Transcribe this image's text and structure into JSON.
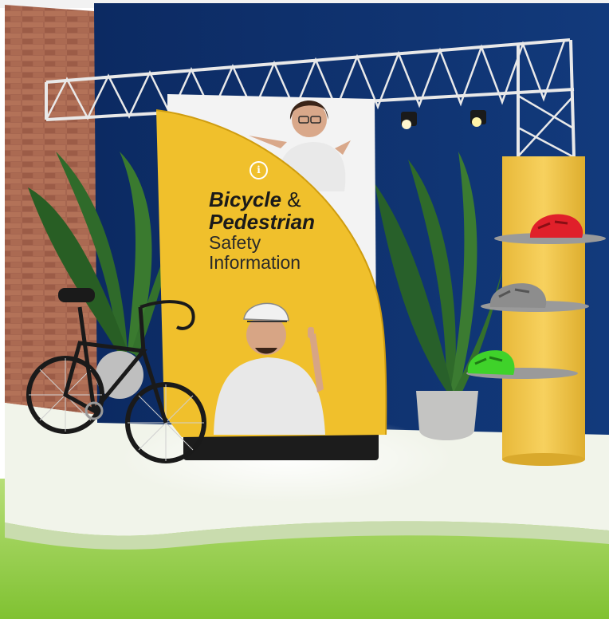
{
  "banner": {
    "title_word1": "Bicycle",
    "title_amp": " &",
    "title_word2": "Pedestrian",
    "subtitle_line1": "Safety",
    "subtitle_line2": "Information",
    "info_symbol": "i"
  },
  "colors": {
    "back_wall": "#0d2f6a",
    "brick_wall": "#9a5d45",
    "banner_yellow": "#f0c02c",
    "pillar_yellow": "#f3c84a",
    "truss": "#e6e6e6",
    "helmet_red": "#e0202a",
    "helmet_grey": "#8d8d8d",
    "helmet_green": "#3fd22a",
    "grass": "#8bc83d",
    "stage": "#eef2e6"
  },
  "icons": [
    "info-icon",
    "spotlight-icon",
    "bicycle-icon",
    "helmet-icon",
    "plant-icon"
  ]
}
